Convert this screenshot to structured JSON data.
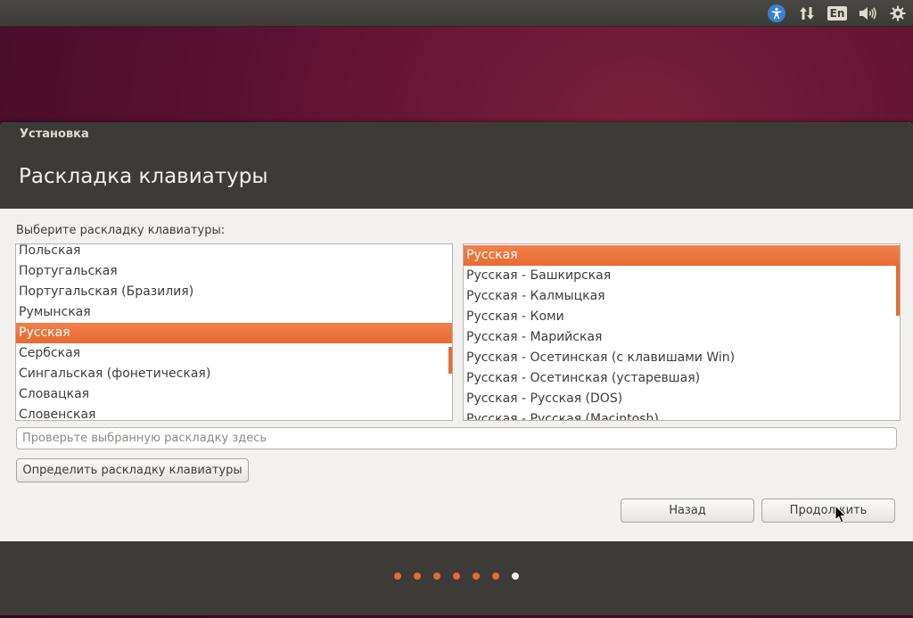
{
  "panel": {
    "language_indicator": "En",
    "icons": [
      "accessibility-icon",
      "network-arrows-icon",
      "keyboard-language-icon",
      "volume-icon",
      "gear-icon"
    ]
  },
  "window": {
    "title": "Установка"
  },
  "page": {
    "title": "Раскладка клавиатуры",
    "prompt": "Выберите раскладку клавиатуры:"
  },
  "layouts": {
    "selected": "Русская",
    "items": [
      "Польская",
      "Португальская",
      "Португальская (Бразилия)",
      "Румынская",
      "Русская",
      "Сербская",
      "Сингальская (фонетическая)",
      "Словацкая",
      "Словенская"
    ]
  },
  "variants": {
    "selected": "Русская",
    "items": [
      "Русская",
      "Русская - Башкирская",
      "Русская - Калмыцкая",
      "Русская - Коми",
      "Русская - Марийская",
      "Русская - Осетинская (с клавишами Win)",
      "Русская - Осетинская (устаревшая)",
      "Русская - Русская (DOS)",
      "Русская - Русская (Macintosh)"
    ]
  },
  "test_field": {
    "placeholder": "Проверьте выбранную раскладку здесь",
    "value": ""
  },
  "buttons": {
    "detect": "Определить раскладку клавиатуры",
    "back": "Назад",
    "continue": "Продолжить"
  },
  "progress": {
    "total_steps": 7,
    "current_step": 7
  },
  "colors": {
    "accent": "#e86a30",
    "header": "#3c3b37",
    "background": "#f2f1f0"
  }
}
